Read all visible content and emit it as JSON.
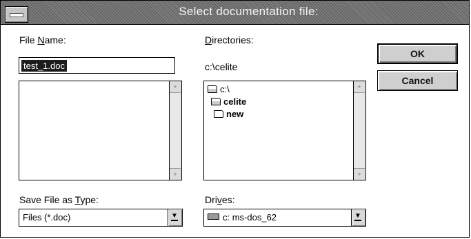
{
  "dialog": {
    "title": "Select documentation file:"
  },
  "filename": {
    "label_prefix": "File ",
    "label_access": "N",
    "label_suffix": "ame:",
    "value": "test_1.doc",
    "list_items": []
  },
  "directories": {
    "label_access": "D",
    "label_suffix": "irectories:",
    "current_path": "c:\\celite",
    "items": [
      {
        "label": "c:\\",
        "icon": "open-folder-icon"
      },
      {
        "label": "celite",
        "icon": "open-folder-icon"
      },
      {
        "label": "new",
        "icon": "folder-icon"
      }
    ]
  },
  "buttons": {
    "ok": "OK",
    "cancel": "Cancel"
  },
  "file_type": {
    "label_prefix": "Save File as ",
    "label_access": "T",
    "label_suffix": "ype:",
    "selected": "Files (*.doc)"
  },
  "drives": {
    "label_prefix": "Dri",
    "label_access": "v",
    "label_suffix": "es:",
    "selected": "c: ms-dos_62",
    "icon": "drive-icon"
  },
  "scroll_glyphs": {
    "up": "+",
    "down": "+"
  }
}
